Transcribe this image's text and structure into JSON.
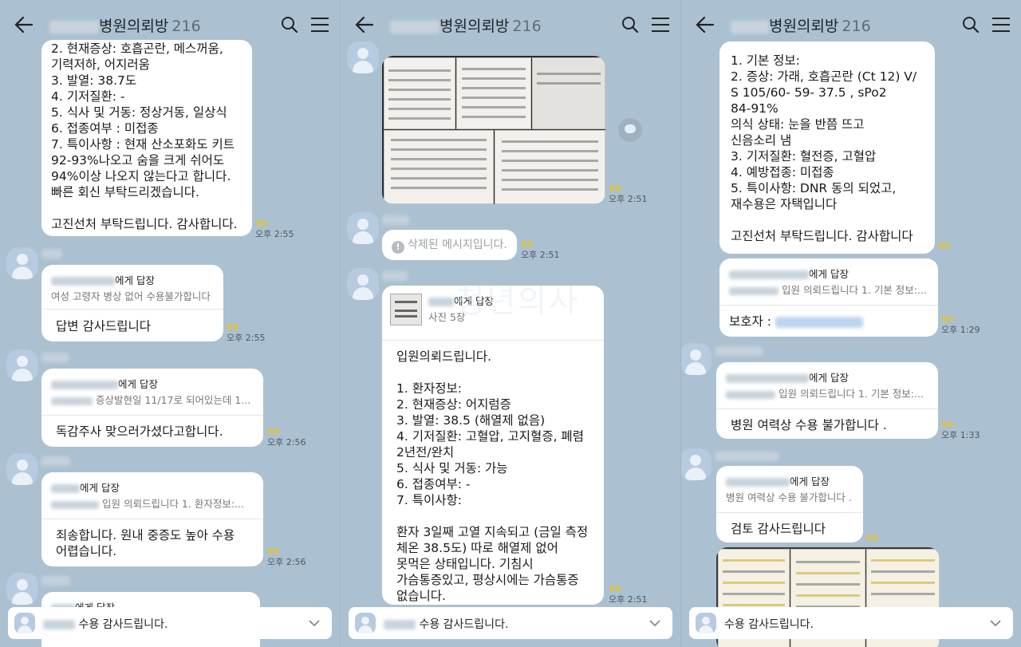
{
  "panels": [
    {
      "header": {
        "title": "병원의뢰방",
        "count": "216"
      },
      "messages": [
        {
          "text": "2. 현재증상: 호흡곤란, 메스꺼움,\n기력저하, 어지러움\n3. 발열: 38.7도\n4. 기저질환: -\n5. 식사 및 거동: 정상거동, 일상식\n6. 접종여부 : 미접종\n7. 특이사항 : 현재 산소포화도 키트\n92-93%나오고 숨을 크게 쉬어도\n94%이상 나오지 않는다고 합니다.\n빠른 회신 부탁드리겠습니다.\n\n고진선처 부탁드립니다. 감사합니다.",
          "unread": "99",
          "time": "오후 2:55"
        },
        {
          "reply_to": "에게 답장",
          "quote": "여성 고령자 병상 없어 수용불가합니다",
          "text": "답변 감사드립니다",
          "unread": "99",
          "time": "오후 2:55"
        },
        {
          "reply_to": "에게 답장",
          "quote": "증상발현일 11/17로 되어있는데 1...",
          "text": "독감주사 맞으러가셨다고합니다.",
          "unread": "99",
          "time": "오후 2:56"
        },
        {
          "reply_to": "에게 답장",
          "quote": "입원 의뢰드립니다 1. 환자정보:...",
          "text": "죄송합니다. 원내 중증도 높아 수용\n어렵습니다.",
          "unread": "99",
          "time": "오후 2:56"
        },
        {
          "reply_to": "에게 답장"
        }
      ],
      "composer": "수용 감사드립니다."
    },
    {
      "header": {
        "title": "병원의뢰방",
        "count": "216"
      },
      "messages": [
        {
          "type": "photo",
          "unread": "99",
          "time": "오후 2:51"
        },
        {
          "type": "deleted",
          "text": "삭제된 메시지입니다.",
          "unread": "99",
          "time": "오후 2:51"
        },
        {
          "reply_to": "에게 답장",
          "quote": "사진 5장",
          "text": "입원의뢰드립니다.\n\n1. 환자정보:\n2. 현재증상: 어지럼증\n3. 발열: 38.5 (해열제 없음)\n4. 기저질환: 고혈압, 고지혈증, 폐렴\n2년전/완치\n5. 식사 및 거동: 가능\n6. 접종여부: -\n7. 특이사항:\n\n환자 3일째 고열 지속되고 (금일 측정\n체온 38.5도) 따로 해열제 없어\n못먹은 상태입니다. 기침시\n가슴통증있고, 평상시에는 가슴통증\n없습니다.",
          "unread": "99",
          "time": "오후 2:51"
        }
      ],
      "watermark": "청년의사",
      "composer": "수용 감사드립니다."
    },
    {
      "header": {
        "title": "병원의뢰방",
        "count": "216"
      },
      "messages": [
        {
          "text": "1. 기본 정보:\n2. 증상: 가래, 호흡곤란 (Ct 12)  V/\nS  105/60- 59- 37.5 , sPo2\n84-91%\n          의식 상태: 눈을 반쯤 뜨고\n신음소리 냄\n3. 기저질환:  혈전증, 고혈압\n4. 예방접종: 미접종\n5. 특이사항:  DNR 동의 되었고,\n재수용은 자택입니다\n\n고진선처 부탁드립니다.  감사합니다",
          "unread": "99"
        },
        {
          "reply_to": "에게 답장",
          "quote": "입원 의뢰드립니다  1. 기본 정보:...",
          "text": "보호자 :",
          "unread": "99",
          "time": "오후 1:29"
        },
        {
          "reply_to": "에게 답장",
          "quote": "입원 의뢰드립니다  1. 기본 정보:...",
          "text": "병원 여력상 수용 불가합니다 .",
          "unread": "99",
          "time": "오후 1:33"
        },
        {
          "reply_to": "에게 답장",
          "quote": "병원 여력상 수용 불가합니다 .",
          "text": "검토 감사드립니다",
          "unread": "99"
        }
      ],
      "composer": "수용 감사드립니다."
    }
  ]
}
